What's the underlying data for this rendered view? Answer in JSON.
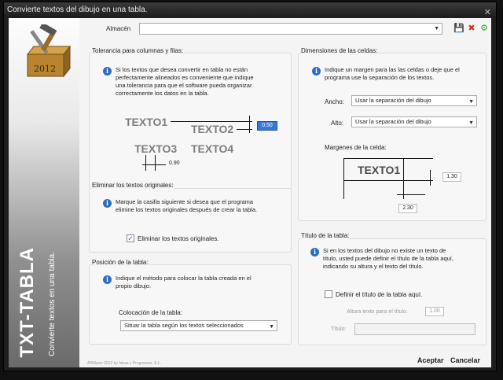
{
  "window": {
    "title": "Convierte textos del dibujo en una tabla."
  },
  "sidebar": {
    "badge_year": "2012",
    "title": "TXT-TABLA",
    "subtitle": "Convierte textos en una tabla."
  },
  "toolbar": {
    "almacen_label": "Almacén",
    "almacen_value": ""
  },
  "tolerancia": {
    "title": "Tolerancia para columnas y filas:",
    "info": [
      "Si los textos que desea convertir en tabla no están",
      "perfectamente alineados es conveniente que indique",
      "una tolerancia para que el software pueda organizar",
      "correctamente los datos en la tabla."
    ],
    "texto1": "TEXTO1",
    "texto2": "TEXTO2",
    "texto3": "TEXTO3",
    "texto4": "TEXTO4",
    "row_tolerance": "0.50",
    "col_tolerance": "0.90"
  },
  "eliminar": {
    "title": "Eliminar los textos originales:",
    "info": [
      "Marque la casilla siguiente si desea que el programa",
      "elimine los textos originales después de crear la tabla."
    ],
    "checkbox_label": "Eliminar los textos originales.",
    "checked": true
  },
  "posicion": {
    "title": "Posición de la tabla:",
    "info": [
      "Indique el método para colocar la tabla creada en el",
      "propio dibujo."
    ],
    "colocacion_label": "Colocación de la tabla:",
    "colocacion_value": "Situar la tabla según los textos seleccionados"
  },
  "dimensiones": {
    "title": "Dimensiones de las celdas:",
    "info": [
      "Indique un margen para las las celdas o deje que el",
      "programa use la separación de los textos."
    ],
    "ancho_label": "Ancho:",
    "ancho_value": "Usar la separación del dibujo",
    "alto_label": "Alto:",
    "alto_value": "Usar la separación del dibujo",
    "margenes_label": "Margenes de la celda:",
    "texto1": "TEXTO1",
    "margin_v": "1.30",
    "margin_h": "2.30"
  },
  "titulo": {
    "title": "Título de la tabla:",
    "info": [
      "Si en los textos del dibujo no existe un texto de",
      "título, usted puede definir el título de la tabla aquí,",
      "indicando su altura y el texto del título."
    ],
    "checkbox_label": "Definir el título de la tabla aquí.",
    "checked": false,
    "altura_label": "Altura texto para el título.",
    "altura_value": "1.00",
    "titulo_label": "Título:",
    "titulo_value": ""
  },
  "footer": {
    "credit": "ARKlpan 2012 by Ideas y Programas, S.L.",
    "accept": "Aceptar",
    "cancel": "Cancelar"
  }
}
